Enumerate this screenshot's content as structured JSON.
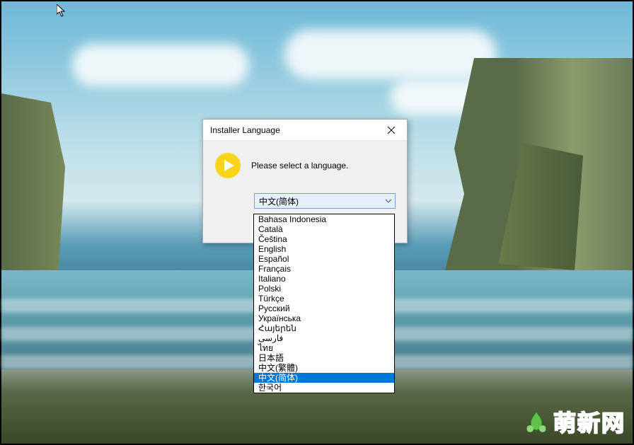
{
  "dialog": {
    "title": "Installer Language",
    "prompt": "Please select a language.",
    "selected": "中文(简体)"
  },
  "languages": [
    "Bahasa Indonesia",
    "Català",
    "Čeština",
    "English",
    "Español",
    "Français",
    "Italiano",
    "Polski",
    "Türkçe",
    "Русский",
    "Українська",
    "Հայերեն",
    "فارسی",
    "ไทย",
    "日本語",
    "中文(繁體)",
    "中文(简体)",
    "한국어"
  ],
  "selectedIndex": 16,
  "watermark": {
    "text": "萌新网"
  }
}
